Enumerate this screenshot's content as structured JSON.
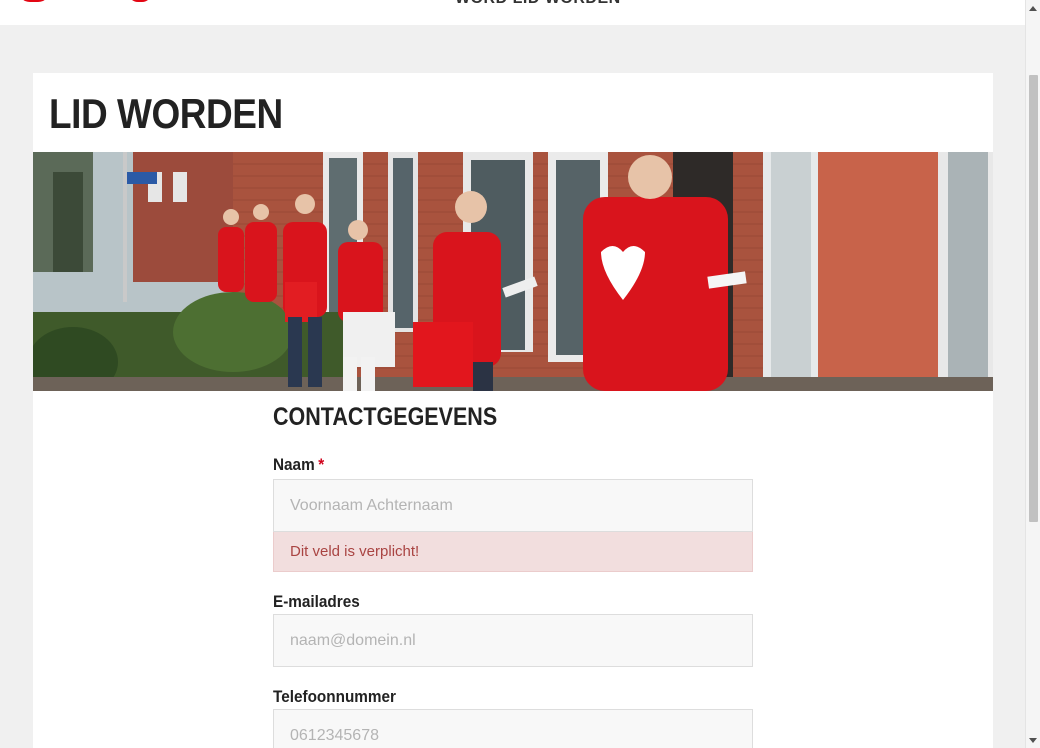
{
  "header": {
    "nav_text": "WORD LID WORDEN"
  },
  "page": {
    "title": "LID WORDEN"
  },
  "form": {
    "section_title": "CONTACTGEGEVENS",
    "fields": {
      "naam": {
        "label": "Naam",
        "required_marker": "*",
        "placeholder": "Voornaam Achternaam",
        "value": "",
        "error": "Dit veld is verplicht!"
      },
      "email": {
        "label": "E-mailadres",
        "placeholder": "naam@domein.nl",
        "value": ""
      },
      "telefoon": {
        "label": "Telefoonnummer",
        "placeholder": "0612345678",
        "value": ""
      }
    }
  },
  "colors": {
    "brand": "#e30613",
    "error_bg": "#f2dede",
    "error_text": "#a94442"
  }
}
